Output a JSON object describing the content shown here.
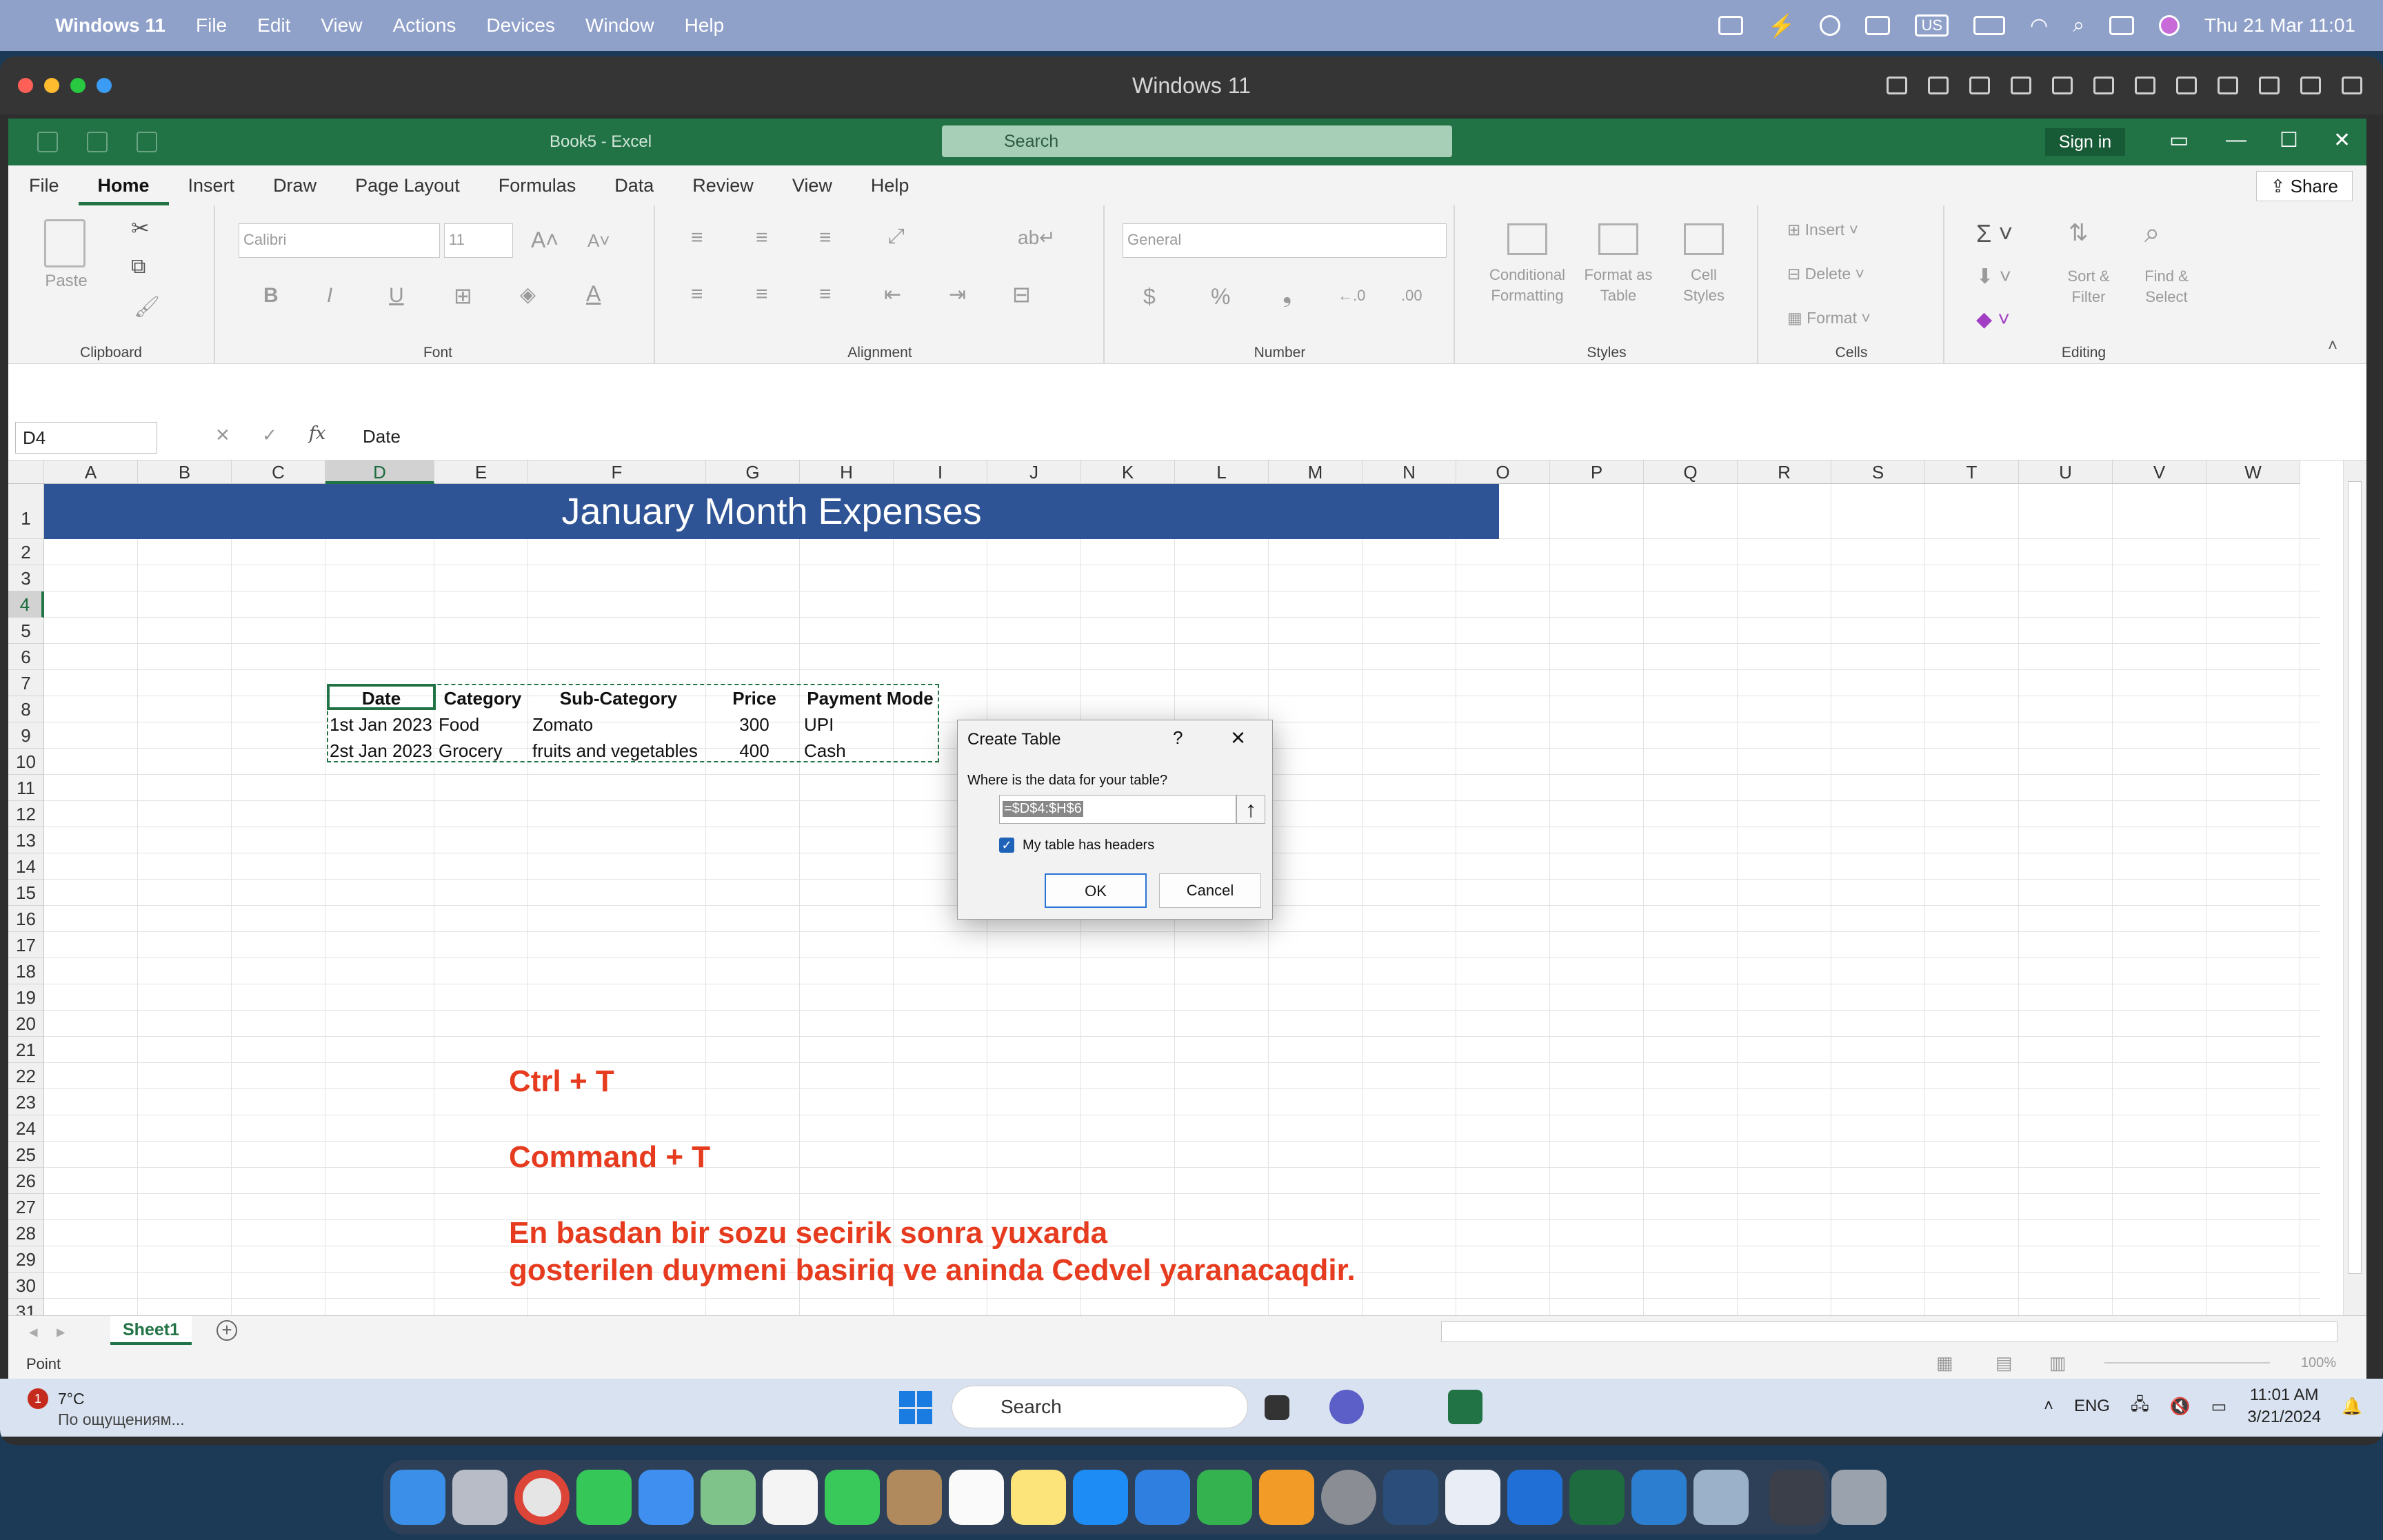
{
  "mac_menubar": {
    "app": "Windows 11",
    "items": [
      "File",
      "Edit",
      "View",
      "Actions",
      "Devices",
      "Window",
      "Help"
    ],
    "status_right": "US",
    "datetime": "Thu 21 Mar  11:01"
  },
  "vm_window": {
    "title": "Windows 11"
  },
  "excel": {
    "doc_title": "Book5  -  Excel",
    "search_placeholder": "Search",
    "sign_in": "Sign in",
    "share": "Share",
    "tabs": [
      "File",
      "Home",
      "Insert",
      "Draw",
      "Page Layout",
      "Formulas",
      "Data",
      "Review",
      "View",
      "Help"
    ],
    "active_tab": "Home",
    "ribbon": {
      "clipboard": {
        "label": "Clipboard",
        "paste": "Paste"
      },
      "font": {
        "label": "Font",
        "font_name": "Calibri",
        "font_size": "11",
        "bold": "B",
        "italic": "I",
        "underline": "U"
      },
      "alignment": {
        "label": "Alignment"
      },
      "number": {
        "label": "Number",
        "format": "General",
        "currency": "$",
        "percent": "%"
      },
      "styles": {
        "label": "Styles",
        "conditional": "Conditional Formatting",
        "format_table": "Format as Table",
        "cell_styles": "Cell Styles"
      },
      "cells": {
        "label": "Cells",
        "insert": "Insert",
        "delete": "Delete",
        "format": "Format"
      },
      "editing": {
        "label": "Editing",
        "sort": "Sort & Filter",
        "find": "Find & Select"
      }
    },
    "name_box": "D4",
    "formula_value": "Date",
    "columns": [
      "A",
      "B",
      "C",
      "D",
      "E",
      "F",
      "G",
      "H",
      "I",
      "J",
      "K",
      "L",
      "M",
      "N",
      "O",
      "P",
      "Q",
      "R",
      "S",
      "T",
      "U",
      "V",
      "W"
    ],
    "rows": [
      "1",
      "2",
      "3",
      "4",
      "5",
      "6",
      "7",
      "8",
      "9",
      "10",
      "11",
      "12",
      "13",
      "14",
      "15",
      "16",
      "17",
      "18",
      "19",
      "20",
      "21",
      "22",
      "23",
      "24",
      "25",
      "26",
      "27",
      "28",
      "29",
      "30",
      "31"
    ],
    "banner_title": "January Month Expenses",
    "table": {
      "headers": [
        "Date",
        "Category",
        "Sub-Category",
        "Price",
        "Payment Mode"
      ],
      "rows": [
        [
          "1st Jan 2023",
          "Food",
          "Zomato",
          "300",
          "UPI"
        ],
        [
          "2st Jan 2023",
          "Grocery",
          "fruits and vegetables",
          "400",
          "Cash"
        ]
      ]
    },
    "notes": {
      "line1": "Ctrl + T",
      "line2": "Command + T",
      "line3": "En basdan bir sozu secirik sonra yuxarda",
      "line4": "gosterilen duymeni basiriq ve aninda Cedvel yaranacaqdir."
    },
    "sheet_tab": "Sheet1",
    "status_mode": "Point",
    "zoom": "100%"
  },
  "dialog": {
    "title": "Create Table",
    "help": "?",
    "prompt": "Where is the data for your table?",
    "range": "=$D$4:$H$6",
    "checkbox_label": "My table has headers",
    "checkbox_checked": true,
    "ok": "OK",
    "cancel": "Cancel"
  },
  "windows_taskbar": {
    "notif_badge": "1",
    "temperature": "7°C",
    "weather_text": "По ощущениям...",
    "search": "Search",
    "lang": "ENG",
    "time": "11:01 AM",
    "date": "3/21/2024"
  }
}
